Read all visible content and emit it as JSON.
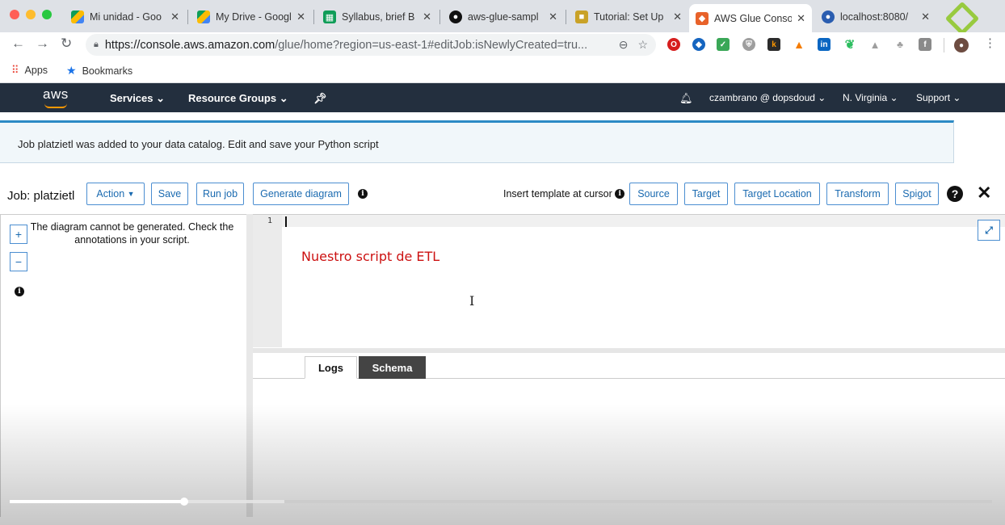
{
  "browser": {
    "tabs": [
      {
        "title": "Mi unidad - Goo",
        "favicon": "google-drive-icon"
      },
      {
        "title": "My Drive - Googl",
        "favicon": "google-drive-icon"
      },
      {
        "title": "Syllabus, brief B",
        "favicon": "google-sheets-icon"
      },
      {
        "title": "aws-glue-sampl",
        "favicon": "github-icon"
      },
      {
        "title": "Tutorial: Set Up",
        "favicon": "aws-docs-icon"
      },
      {
        "title": "AWS Glue Conso",
        "favicon": "aws-glue-icon"
      },
      {
        "title": "localhost:8080/",
        "favicon": "zeppelin-icon"
      }
    ],
    "active_tab_index": 5,
    "url_host": "https://console.aws.amazon.com",
    "url_rest": "/glue/home?region=us-east-1#editJob:isNewlyCreated=tru...",
    "bookmarks": [
      {
        "label": "Apps",
        "icon": "apps-grid-icon"
      },
      {
        "label": "Bookmarks",
        "icon": "star-icon"
      }
    ]
  },
  "aws_nav": {
    "logo": "aws",
    "services": "Services",
    "resource_groups": "Resource Groups",
    "user": "czambrano @ dopsdoud",
    "region": "N. Virginia",
    "support": "Support"
  },
  "notification": "Job platzietl was added to your data catalog. Edit and save your Python script",
  "job": {
    "title": "Job: platzietl",
    "buttons": {
      "action": "Action",
      "save": "Save",
      "run_job": "Run job",
      "generate_diagram": "Generate diagram"
    },
    "insert_template_label": "Insert template at cursor",
    "templates": [
      "Source",
      "Target",
      "Target Location",
      "Transform",
      "Spigot"
    ]
  },
  "diagram": {
    "message": "The diagram cannot be generated. Check the annotations in your script.",
    "zoom_in": "+",
    "zoom_out": "−"
  },
  "editor": {
    "line_number": "1",
    "annotation_text": "Nuestro script de ETL"
  },
  "bottom_tabs": {
    "logs": "Logs",
    "schema": "Schema"
  },
  "video": {
    "progress_played": 0.178,
    "progress_buffered": 0.28
  },
  "colors": {
    "aws_nav_bg": "#232f3e",
    "aws_orange": "#ff9900",
    "button_blue": "#1a6ab0",
    "annotation_red": "#cc1111"
  }
}
